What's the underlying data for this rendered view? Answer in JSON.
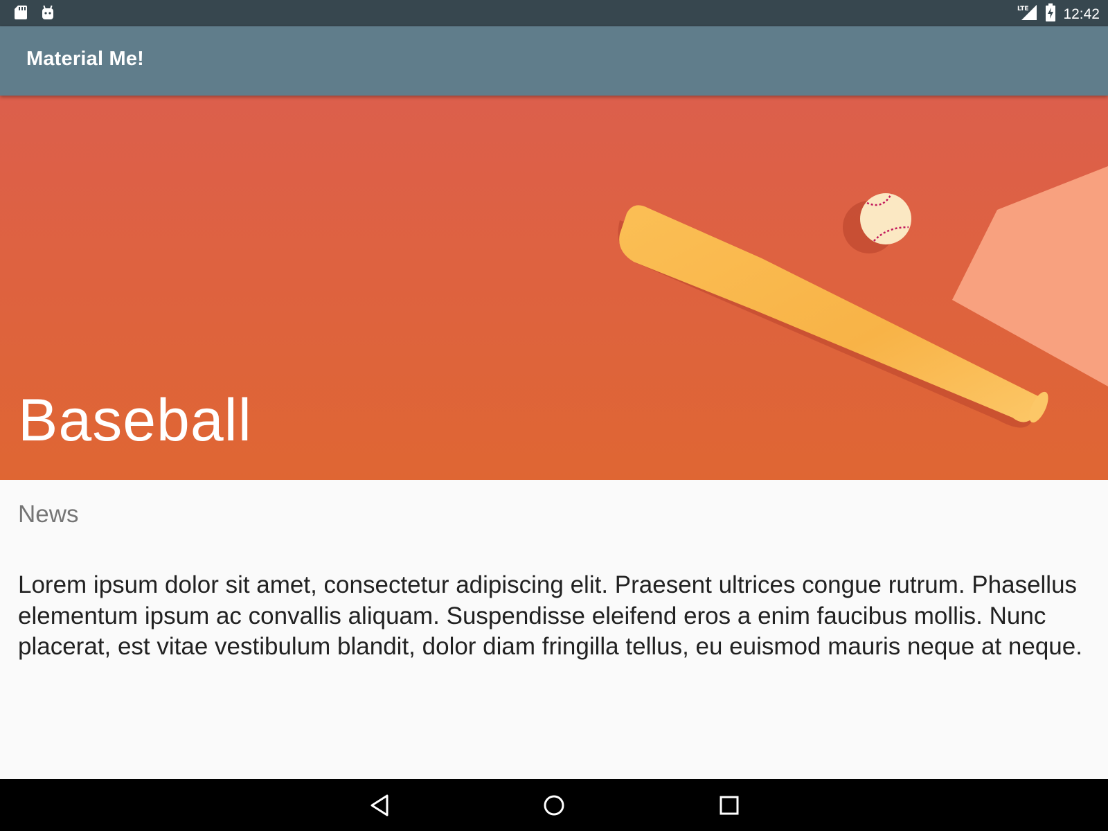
{
  "status_bar": {
    "time": "12:42",
    "network": "LTE",
    "icons": [
      "sd-card-icon",
      "android-icon",
      "lte-signal-icon",
      "battery-charging-icon"
    ]
  },
  "app_bar": {
    "title": "Material Me!",
    "color": "#607d8b"
  },
  "card": {
    "image": "baseball-bat-and-ball-image",
    "title": "Baseball",
    "subtitle": "News",
    "body": "Lorem ipsum dolor sit amet, consectetur adipiscing elit. Praesent ultrices congue rutrum. Phasellus elementum ipsum ac convallis aliquam. Suspendisse eleifend eros a enim faucibus mollis. Nunc placerat, est vitae vestibulum blandit, dolor diam fringilla tellus, eu euismod mauris neque at neque."
  },
  "colors": {
    "status_bar": "#37474f",
    "hero_top": "#dc5f4c",
    "hero_bottom": "#df6633",
    "bat": "#f7b84c",
    "plate": "#f8a17f"
  },
  "nav_bar": {
    "icons": [
      "back-icon",
      "home-icon",
      "recents-icon"
    ]
  }
}
